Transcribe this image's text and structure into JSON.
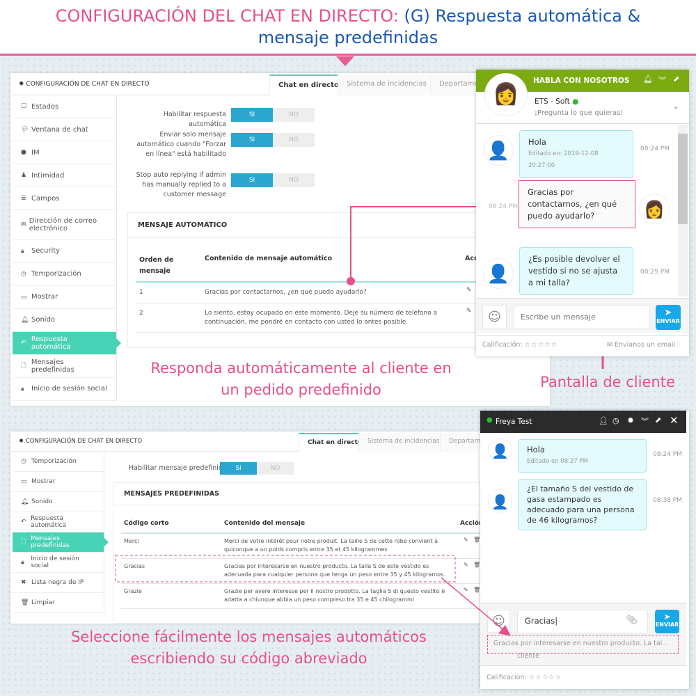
{
  "title": {
    "part1": "CONFIGURACIÓN DEL CHAT EN DIRECTO:",
    "part2": "(G) Respuesta automática &",
    "line2": "mensaje predefinidas"
  },
  "colors": {
    "accent": "#49d3b6",
    "toggle_on": "#2aa6cf",
    "annotation": "#e6508b",
    "chat_header": "#7bab10",
    "send": "#16a8e8"
  },
  "panel1": {
    "header": "CONFIGURACIÓN DE CHAT EN DIRECTO",
    "tabs": [
      "Chat en directo",
      "Sistema de incidencias",
      "Departame"
    ],
    "sidebar": [
      {
        "label": "Estados",
        "icon": "calendar-icon"
      },
      {
        "label": "Ventana de chat",
        "icon": "comment-icon"
      },
      {
        "label": "IM",
        "icon": "comments-icon"
      },
      {
        "label": "Intimidad",
        "icon": "user-icon"
      },
      {
        "label": "Campos",
        "icon": "list-icon"
      },
      {
        "label": "Dirección de correo electrónico",
        "icon": "envelope-icon"
      },
      {
        "label": "Security",
        "icon": "lock-icon"
      },
      {
        "label": "Temporización",
        "icon": "clock-icon"
      },
      {
        "label": "Mostrar",
        "icon": "desktop-icon"
      },
      {
        "label": "Sonido",
        "icon": "bell-icon"
      },
      {
        "label": "Respuesta automática",
        "icon": "reply-icon",
        "active": true
      },
      {
        "label": "Mensajes predefinidas",
        "icon": "file-icon"
      },
      {
        "label": "Inicio de sesión social",
        "icon": "lock-icon"
      }
    ],
    "settings": [
      {
        "label": "Habilitar respuesta automática",
        "value": "SI",
        "on": "SI",
        "off": "NO"
      },
      {
        "label": "Enviar solo mensaje automático cuando \"Forzar en línea\" está habilitado",
        "value": "SI",
        "on": "SI",
        "off": "NO"
      },
      {
        "label": "Stop auto replying if admin has manually replied to a customer message",
        "value": "SI",
        "on": "SI",
        "off": "NO"
      }
    ],
    "box_title": "MENSAJE AUTOMÁTICO",
    "columns": [
      "Orden de mensaje",
      "Contenido de mensaje automático",
      "Acc"
    ],
    "rows": [
      {
        "order": "1",
        "content": "Gracias por contactarnos, ¿en qué puedo ayudarlo?"
      },
      {
        "order": "2",
        "content": "Lo siento, estoy ocupado en este momento. Deje su número de teléfono a continuación, me pondré en contacto con usted lo antes posible."
      }
    ]
  },
  "chat1": {
    "header": "HABLA CON NOSOTROS",
    "name": "ETS - Soft",
    "status": "online",
    "subtitle": "¡Pregunta lo que quieras!",
    "messages": [
      {
        "text": "Hola",
        "edited": "Editado en: 2019-12-08 20:27:00",
        "time": "08:24 PM",
        "from": "customer"
      },
      {
        "text": "Gracias por contactarnos, ¿en qué puedo ayudarlo?",
        "time": "08:24 PM",
        "from": "admin"
      },
      {
        "text": "¿Es posible devolver el vestido si no se ajusta a mi talla?",
        "time": "08:25 PM",
        "from": "customer"
      }
    ],
    "placeholder": "Escribe un mensaje",
    "send": "ENVIAR",
    "rating_label": "Calificación:",
    "rating": 0,
    "email_link": "Envianos un email"
  },
  "annotation1": {
    "line1": "Responda automáticamente al cliente en",
    "line2": "un pedido predefinido",
    "client": "Pantalla de cliente"
  },
  "panel2": {
    "header": "CONFIGURACIÓN DE CHAT EN DIRECTO",
    "tabs": [
      "Chat en directo",
      "Sistema de incidencias",
      "Departame"
    ],
    "sidebar": [
      {
        "label": "Temporización",
        "icon": "clock-icon"
      },
      {
        "label": "Mostrar",
        "icon": "desktop-icon"
      },
      {
        "label": "Sonido",
        "icon": "bell-icon"
      },
      {
        "label": "Respuesta automática",
        "icon": "reply-icon"
      },
      {
        "label": "Mensajes predefinidas",
        "icon": "file-icon",
        "active": true
      },
      {
        "label": "Inicio de sesión social",
        "icon": "lock-icon"
      },
      {
        "label": "Lista negra de IP",
        "icon": "times-icon"
      },
      {
        "label": "Limpiar",
        "icon": "trash-icon"
      }
    ],
    "setting": {
      "label": "Habilitar mensaje predefinidas",
      "value": "SI",
      "on": "SI",
      "off": "NO"
    },
    "box_title": "MENSAJES PREDEFINIDAS",
    "columns": [
      "Código corto",
      "Contenido del mensaje",
      "Acción"
    ],
    "rows": [
      {
        "code": "Merci",
        "content": "Merci de votre intérêt pour notre produit. La taille S de cette robe convient à quiconque a un poids compris entre 35 et 45 kilogrammes"
      },
      {
        "code": "Gracias",
        "content": "Gracias por interesarse en nuestro producto. La talla S de este vestido es adecuada para cualquier persona que tenga un peso entre 35 y 45 kilogramos."
      },
      {
        "code": "Grazie",
        "content": "Grazie per avere interesse per il nostro prodotto. La taglia S di questo vestito è adatta a chiunque abbia un peso compreso tra 35 e 45 chilogrammi"
      }
    ]
  },
  "chat2": {
    "name": "Freya Test",
    "status": "online",
    "messages": [
      {
        "text": "Hola",
        "edited": "Editado en 08:27 PM",
        "time": "08:24 PM"
      },
      {
        "text": "¿El tamaño S del vestido de gasa estampado es adecuado para una persona de 46 kilogramos?",
        "time": "08:38 PM"
      }
    ],
    "input_value": "Gracias",
    "suggestion": "Gracias por interesarse en nuestro producto. La tal...",
    "suggestion_sub": "cliente",
    "send": "ENVIAR",
    "rating_label": "Calificación:",
    "rating": 0
  },
  "annotation2": {
    "line1": "Seleccione fácilmente los mensajes automáticos",
    "line2": "escribiendo su código abreviado"
  }
}
